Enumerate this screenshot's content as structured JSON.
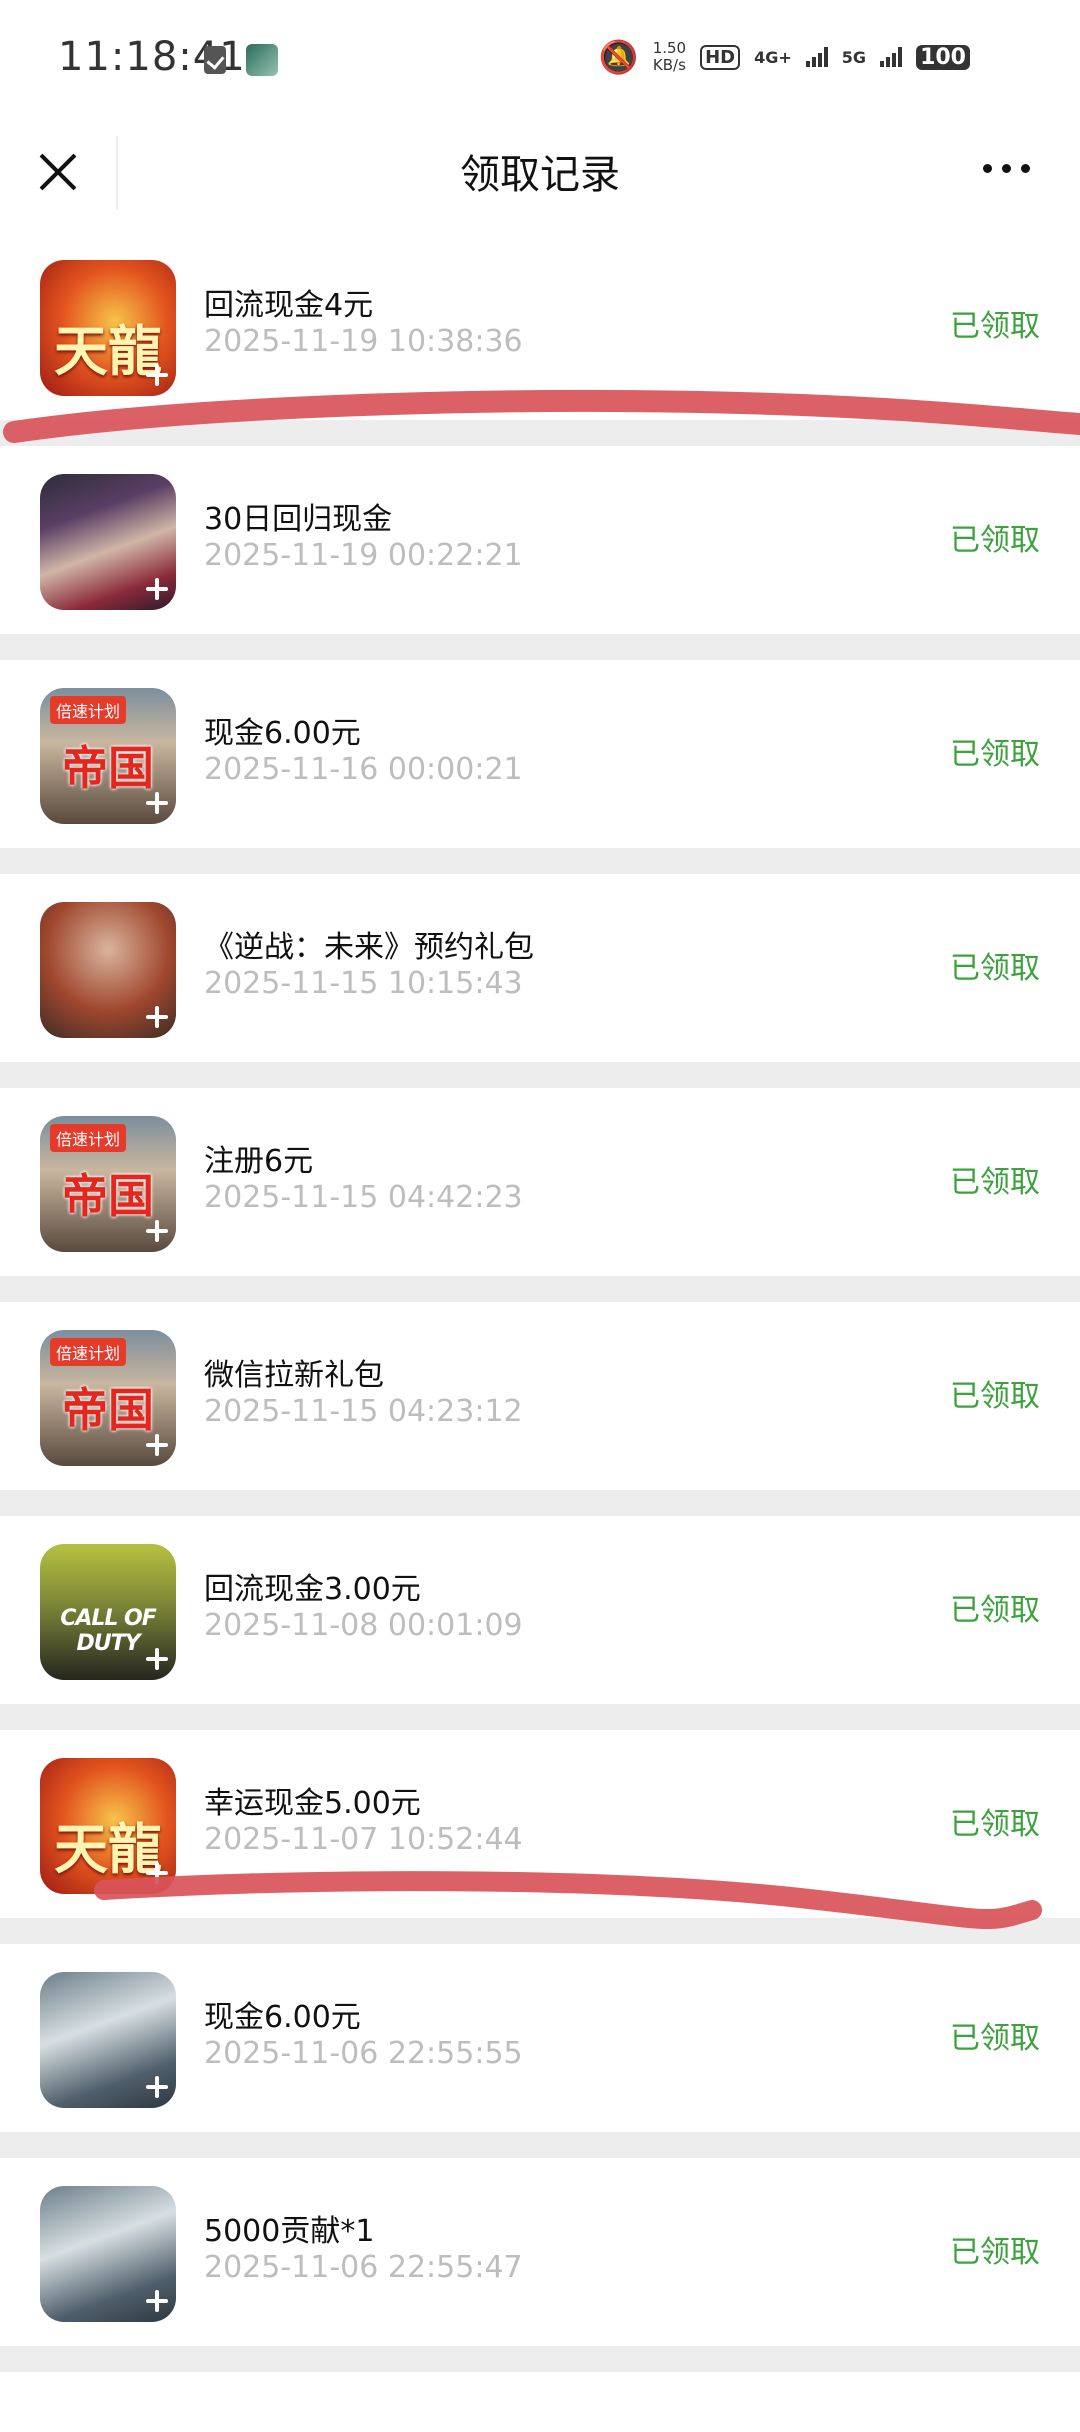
{
  "status_bar": {
    "time": "11:18:41",
    "speed_value": "1.50",
    "speed_unit": "KB/s",
    "hd_label": "HD",
    "net1": "4G+",
    "net2": "5G",
    "battery": "100"
  },
  "nav": {
    "title": "领取记录"
  },
  "status_color": "#3da23d",
  "records": [
    {
      "title": "回流现金4元",
      "time": "2025-11-19 10:38:36",
      "status": "已领取",
      "icon": "tianlong-app-icon",
      "icon_text": "天龍"
    },
    {
      "title": "30日回归现金",
      "time": "2025-11-19 00:22:21",
      "status": "已领取",
      "icon": "hero-app-icon",
      "icon_text": ""
    },
    {
      "title": "现金6.00元",
      "time": "2025-11-16 00:00:21",
      "status": "已领取",
      "icon": "diguo-app-icon",
      "icon_text": "帝国",
      "icon_tag": "倍速计划"
    },
    {
      "title": "《逆战：未来》预约礼包",
      "time": "2025-11-15 10:15:43",
      "status": "已领取",
      "icon": "nizhan-app-icon",
      "icon_text": ""
    },
    {
      "title": "注册6元",
      "time": "2025-11-15 04:42:23",
      "status": "已领取",
      "icon": "diguo-app-icon",
      "icon_text": "帝国",
      "icon_tag": "倍速计划"
    },
    {
      "title": "微信拉新礼包",
      "time": "2025-11-15 04:23:12",
      "status": "已领取",
      "icon": "diguo-app-icon",
      "icon_text": "帝国",
      "icon_tag": "倍速计划"
    },
    {
      "title": "回流现金3.00元",
      "time": "2025-11-08 00:01:09",
      "status": "已领取",
      "icon": "call-of-duty-app-icon",
      "icon_text": "CALL OF DUTY"
    },
    {
      "title": "幸运现金5.00元",
      "time": "2025-11-07 10:52:44",
      "status": "已领取",
      "icon": "tianlong-app-icon",
      "icon_text": "天龍"
    },
    {
      "title": "现金6.00元",
      "time": "2025-11-06 22:55:55",
      "status": "已领取",
      "icon": "swordsman-app-icon",
      "icon_text": ""
    },
    {
      "title": "5000贡献*1",
      "time": "2025-11-06 22:55:47",
      "status": "已领取",
      "icon": "swordsman-app-icon",
      "icon_text": ""
    }
  ],
  "annotation_color": "#d9545a"
}
